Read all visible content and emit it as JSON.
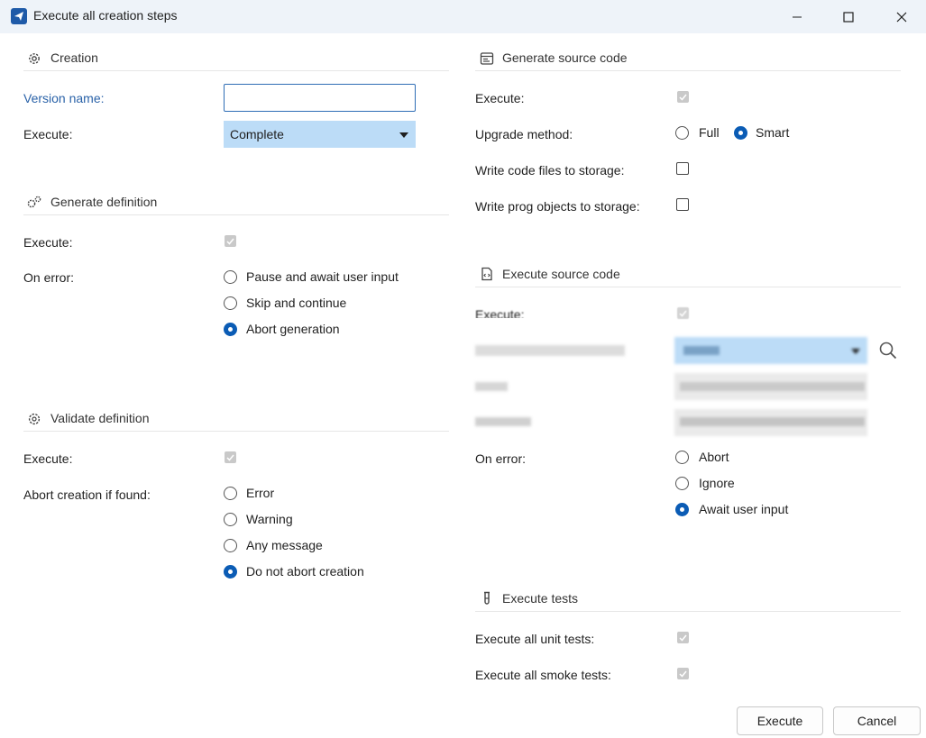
{
  "window": {
    "title": "Execute all creation steps"
  },
  "creation": {
    "title": "Creation",
    "version_name_label": "Version name:",
    "version_name_value": "",
    "execute_label": "Execute:",
    "execute_value": "Complete"
  },
  "generate_definition": {
    "title": "Generate definition",
    "execute_label": "Execute:",
    "on_error_label": "On error:",
    "options": [
      "Pause and await user input",
      "Skip and continue",
      "Abort generation"
    ],
    "selected": "Abort generation"
  },
  "validate_definition": {
    "title": "Validate definition",
    "execute_label": "Execute:",
    "abort_label": "Abort creation if found:",
    "options": [
      "Error",
      "Warning",
      "Any message",
      "Do not abort creation"
    ],
    "selected": "Do not abort creation"
  },
  "generate_source_code": {
    "title": "Generate source code",
    "execute_label": "Execute:",
    "upgrade_label": "Upgrade method:",
    "upgrade_options": [
      "Full",
      "Smart"
    ],
    "upgrade_selected": "Smart",
    "write_code_label": "Write code files to storage:",
    "write_prog_label": "Write prog objects to storage:"
  },
  "execute_source_code": {
    "title": "Execute source code",
    "execute_label": "Execute:",
    "on_error_label": "On error:",
    "options": [
      "Abort",
      "Ignore",
      "Await user input"
    ],
    "selected": "Await user input"
  },
  "execute_tests": {
    "title": "Execute tests",
    "unit_label": "Execute all unit tests:",
    "smoke_label": "Execute all smoke tests:"
  },
  "buttons": {
    "execute": "Execute",
    "cancel": "Cancel"
  },
  "colors": {
    "accent": "#0b5cb5",
    "dropdown_bg": "#bcdcf7",
    "label_blue": "#2a62a8"
  }
}
